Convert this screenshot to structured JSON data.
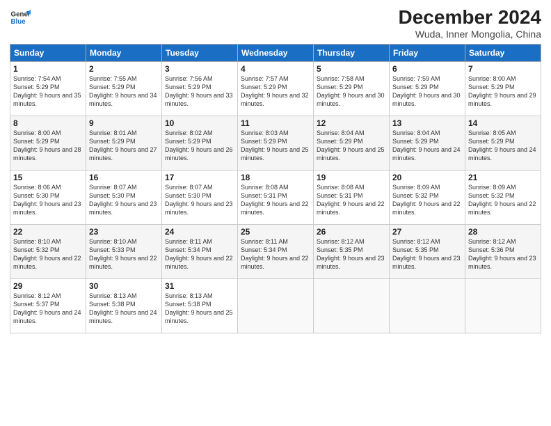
{
  "header": {
    "logo_line1": "General",
    "logo_line2": "Blue",
    "month": "December 2024",
    "location": "Wuda, Inner Mongolia, China"
  },
  "weekdays": [
    "Sunday",
    "Monday",
    "Tuesday",
    "Wednesday",
    "Thursday",
    "Friday",
    "Saturday"
  ],
  "weeks": [
    [
      {
        "day": "1",
        "sunrise": "Sunrise: 7:54 AM",
        "sunset": "Sunset: 5:29 PM",
        "daylight": "Daylight: 9 hours and 35 minutes."
      },
      {
        "day": "2",
        "sunrise": "Sunrise: 7:55 AM",
        "sunset": "Sunset: 5:29 PM",
        "daylight": "Daylight: 9 hours and 34 minutes."
      },
      {
        "day": "3",
        "sunrise": "Sunrise: 7:56 AM",
        "sunset": "Sunset: 5:29 PM",
        "daylight": "Daylight: 9 hours and 33 minutes."
      },
      {
        "day": "4",
        "sunrise": "Sunrise: 7:57 AM",
        "sunset": "Sunset: 5:29 PM",
        "daylight": "Daylight: 9 hours and 32 minutes."
      },
      {
        "day": "5",
        "sunrise": "Sunrise: 7:58 AM",
        "sunset": "Sunset: 5:29 PM",
        "daylight": "Daylight: 9 hours and 30 minutes."
      },
      {
        "day": "6",
        "sunrise": "Sunrise: 7:59 AM",
        "sunset": "Sunset: 5:29 PM",
        "daylight": "Daylight: 9 hours and 30 minutes."
      },
      {
        "day": "7",
        "sunrise": "Sunrise: 8:00 AM",
        "sunset": "Sunset: 5:29 PM",
        "daylight": "Daylight: 9 hours and 29 minutes."
      }
    ],
    [
      {
        "day": "8",
        "sunrise": "Sunrise: 8:00 AM",
        "sunset": "Sunset: 5:29 PM",
        "daylight": "Daylight: 9 hours and 28 minutes."
      },
      {
        "day": "9",
        "sunrise": "Sunrise: 8:01 AM",
        "sunset": "Sunset: 5:29 PM",
        "daylight": "Daylight: 9 hours and 27 minutes."
      },
      {
        "day": "10",
        "sunrise": "Sunrise: 8:02 AM",
        "sunset": "Sunset: 5:29 PM",
        "daylight": "Daylight: 9 hours and 26 minutes."
      },
      {
        "day": "11",
        "sunrise": "Sunrise: 8:03 AM",
        "sunset": "Sunset: 5:29 PM",
        "daylight": "Daylight: 9 hours and 25 minutes."
      },
      {
        "day": "12",
        "sunrise": "Sunrise: 8:04 AM",
        "sunset": "Sunset: 5:29 PM",
        "daylight": "Daylight: 9 hours and 25 minutes."
      },
      {
        "day": "13",
        "sunrise": "Sunrise: 8:04 AM",
        "sunset": "Sunset: 5:29 PM",
        "daylight": "Daylight: 9 hours and 24 minutes."
      },
      {
        "day": "14",
        "sunrise": "Sunrise: 8:05 AM",
        "sunset": "Sunset: 5:29 PM",
        "daylight": "Daylight: 9 hours and 24 minutes."
      }
    ],
    [
      {
        "day": "15",
        "sunrise": "Sunrise: 8:06 AM",
        "sunset": "Sunset: 5:30 PM",
        "daylight": "Daylight: 9 hours and 23 minutes."
      },
      {
        "day": "16",
        "sunrise": "Sunrise: 8:07 AM",
        "sunset": "Sunset: 5:30 PM",
        "daylight": "Daylight: 9 hours and 23 minutes."
      },
      {
        "day": "17",
        "sunrise": "Sunrise: 8:07 AM",
        "sunset": "Sunset: 5:30 PM",
        "daylight": "Daylight: 9 hours and 23 minutes."
      },
      {
        "day": "18",
        "sunrise": "Sunrise: 8:08 AM",
        "sunset": "Sunset: 5:31 PM",
        "daylight": "Daylight: 9 hours and 22 minutes."
      },
      {
        "day": "19",
        "sunrise": "Sunrise: 8:08 AM",
        "sunset": "Sunset: 5:31 PM",
        "daylight": "Daylight: 9 hours and 22 minutes."
      },
      {
        "day": "20",
        "sunrise": "Sunrise: 8:09 AM",
        "sunset": "Sunset: 5:32 PM",
        "daylight": "Daylight: 9 hours and 22 minutes."
      },
      {
        "day": "21",
        "sunrise": "Sunrise: 8:09 AM",
        "sunset": "Sunset: 5:32 PM",
        "daylight": "Daylight: 9 hours and 22 minutes."
      }
    ],
    [
      {
        "day": "22",
        "sunrise": "Sunrise: 8:10 AM",
        "sunset": "Sunset: 5:32 PM",
        "daylight": "Daylight: 9 hours and 22 minutes."
      },
      {
        "day": "23",
        "sunrise": "Sunrise: 8:10 AM",
        "sunset": "Sunset: 5:33 PM",
        "daylight": "Daylight: 9 hours and 22 minutes."
      },
      {
        "day": "24",
        "sunrise": "Sunrise: 8:11 AM",
        "sunset": "Sunset: 5:34 PM",
        "daylight": "Daylight: 9 hours and 22 minutes."
      },
      {
        "day": "25",
        "sunrise": "Sunrise: 8:11 AM",
        "sunset": "Sunset: 5:34 PM",
        "daylight": "Daylight: 9 hours and 22 minutes."
      },
      {
        "day": "26",
        "sunrise": "Sunrise: 8:12 AM",
        "sunset": "Sunset: 5:35 PM",
        "daylight": "Daylight: 9 hours and 23 minutes."
      },
      {
        "day": "27",
        "sunrise": "Sunrise: 8:12 AM",
        "sunset": "Sunset: 5:35 PM",
        "daylight": "Daylight: 9 hours and 23 minutes."
      },
      {
        "day": "28",
        "sunrise": "Sunrise: 8:12 AM",
        "sunset": "Sunset: 5:36 PM",
        "daylight": "Daylight: 9 hours and 23 minutes."
      }
    ],
    [
      {
        "day": "29",
        "sunrise": "Sunrise: 8:12 AM",
        "sunset": "Sunset: 5:37 PM",
        "daylight": "Daylight: 9 hours and 24 minutes."
      },
      {
        "day": "30",
        "sunrise": "Sunrise: 8:13 AM",
        "sunset": "Sunset: 5:38 PM",
        "daylight": "Daylight: 9 hours and 24 minutes."
      },
      {
        "day": "31",
        "sunrise": "Sunrise: 8:13 AM",
        "sunset": "Sunset: 5:38 PM",
        "daylight": "Daylight: 9 hours and 25 minutes."
      },
      null,
      null,
      null,
      null
    ]
  ]
}
